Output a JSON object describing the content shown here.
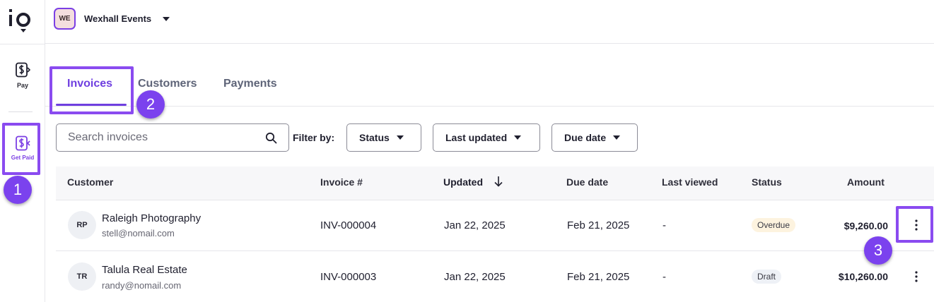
{
  "app": {
    "logo_text": "io"
  },
  "rail": {
    "items": [
      {
        "label": "Pay",
        "icon": "dollar-doc-icon"
      },
      {
        "label": "Get Paid",
        "icon": "dollar-doc-icon",
        "active_color": "#7b3fe4"
      }
    ]
  },
  "org": {
    "initials": "WE",
    "name": "Wexhall Events"
  },
  "tabs": [
    {
      "label": "Invoices",
      "active": true
    },
    {
      "label": "Customers",
      "active": false
    },
    {
      "label": "Payments",
      "active": false
    }
  ],
  "search": {
    "placeholder": "Search invoices",
    "value": ""
  },
  "filters": {
    "label": "Filter by:",
    "options": [
      "Status",
      "Last updated",
      "Due date"
    ]
  },
  "table": {
    "columns": [
      "Customer",
      "Invoice #",
      "Updated",
      "Due date",
      "Last viewed",
      "Status",
      "Amount"
    ],
    "sorted_column": "Updated",
    "rows": [
      {
        "initials": "RP",
        "customer": "Raleigh Photography",
        "email": "stell@nomail.com",
        "invoice": "INV-000004",
        "updated": "Jan 22, 2025",
        "due": "Feb 21, 2025",
        "viewed": "-",
        "status": "Overdue",
        "amount": "$9,260.00"
      },
      {
        "initials": "TR",
        "customer": "Talula Real Estate",
        "email": "randy@nomail.com",
        "invoice": "INV-000003",
        "updated": "Jan 22, 2025",
        "due": "Feb 21, 2025",
        "viewed": "-",
        "status": "Draft",
        "amount": "$10,260.00"
      }
    ]
  },
  "annotations": {
    "badges": [
      "1",
      "2",
      "3"
    ],
    "highlight_color": "#8a4bf0"
  },
  "colors": {
    "accent": "#6f3fe0",
    "overdue_bg": "#fdf3df",
    "draft_bg": "#eef1f6"
  }
}
